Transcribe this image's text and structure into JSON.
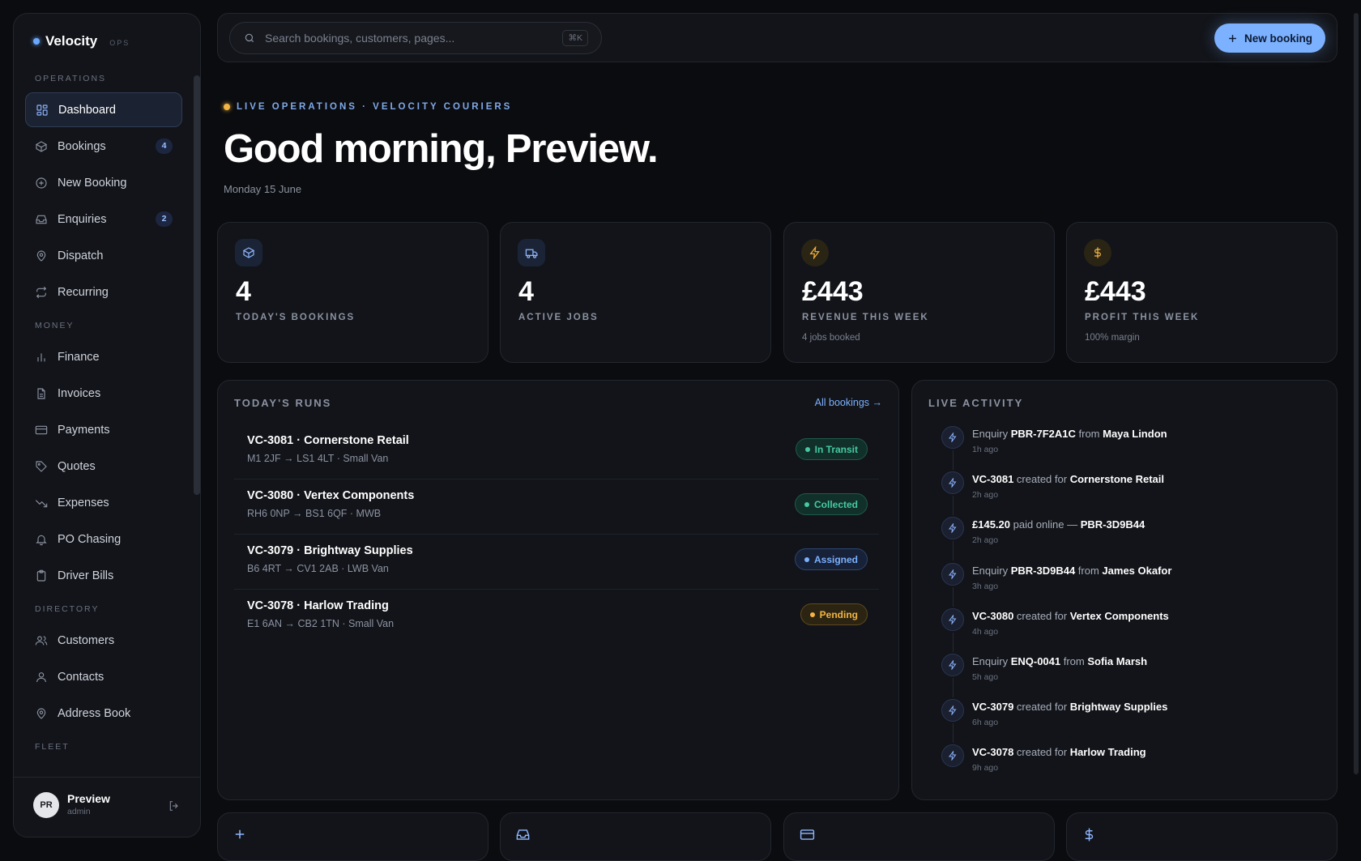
{
  "brand": {
    "name": "Velocity",
    "sub": "OPS"
  },
  "sidebar": {
    "sections": {
      "operations": "OPERATIONS",
      "money": "MONEY",
      "directory": "DIRECTORY",
      "fleet": "FLEET"
    },
    "items": [
      {
        "label": "Dashboard",
        "icon": "dashboard-icon"
      },
      {
        "label": "Bookings",
        "icon": "box-icon",
        "badge": "4"
      },
      {
        "label": "New Booking",
        "icon": "plus-circle-icon"
      },
      {
        "label": "Enquiries",
        "icon": "inbox-icon",
        "badge": "2"
      },
      {
        "label": "Dispatch",
        "icon": "map-pin-icon"
      },
      {
        "label": "Recurring",
        "icon": "repeat-icon"
      },
      {
        "label": "Finance",
        "icon": "bar-chart-icon"
      },
      {
        "label": "Invoices",
        "icon": "file-icon"
      },
      {
        "label": "Payments",
        "icon": "credit-card-icon"
      },
      {
        "label": "Quotes",
        "icon": "tag-icon"
      },
      {
        "label": "Expenses",
        "icon": "trending-down-icon"
      },
      {
        "label": "PO Chasing",
        "icon": "bell-icon"
      },
      {
        "label": "Driver Bills",
        "icon": "clipboard-icon"
      },
      {
        "label": "Customers",
        "icon": "users-icon"
      },
      {
        "label": "Contacts",
        "icon": "user-icon"
      },
      {
        "label": "Address Book",
        "icon": "map-pin-icon"
      }
    ],
    "user": {
      "initials": "PR",
      "name": "Preview",
      "role": "admin"
    }
  },
  "topbar": {
    "search_placeholder": "Search bookings, customers, pages...",
    "search_shortcut": "⌘K",
    "new_booking_label": "New booking"
  },
  "hero": {
    "eyebrow": "LIVE OPERATIONS · VELOCITY COURIERS",
    "greeting": "Good morning, Preview.",
    "date": "Monday 15 June"
  },
  "stats": [
    {
      "value": "4",
      "label": "TODAY'S BOOKINGS",
      "sub": "",
      "icon": "box-icon"
    },
    {
      "value": "4",
      "label": "ACTIVE JOBS",
      "sub": "",
      "icon": "truck-icon"
    },
    {
      "value": "£443",
      "label": "REVENUE THIS WEEK",
      "sub": "4 jobs booked",
      "icon": "bolt-icon"
    },
    {
      "value": "£443",
      "label": "PROFIT THIS WEEK",
      "sub": "100% margin",
      "icon": "dollar-icon"
    }
  ],
  "runs": {
    "title": "TODAY'S RUNS",
    "link": "All bookings →",
    "items": [
      {
        "title": "VC-3081 · Cornerstone Retail",
        "route": "M1 2JF → LS1 4LT · Small Van",
        "status": "In Transit",
        "status_color": "#46c9a0"
      },
      {
        "title": "VC-3080 · Vertex Components",
        "route": "RH6 0NP → BS1 6QF · MWB",
        "status": "Collected",
        "status_color": "#46c9a0"
      },
      {
        "title": "VC-3079 · Brightway Supplies",
        "route": "B6 4RT → CV1 2AB · LWB Van",
        "status": "Assigned",
        "status_color": "#7cb1ff"
      },
      {
        "title": "VC-3078 · Harlow Trading",
        "route": "E1 6AN → CB2 1TN · Small Van",
        "status": "Pending",
        "status_color": "#f2b544"
      }
    ]
  },
  "activity": {
    "title": "LIVE ACTIVITY",
    "items": [
      {
        "p1": "Enquiry ",
        "b1": "PBR-7F2A1C",
        "p2": " from ",
        "b2": "Maya Lindon",
        "time": "1h ago"
      },
      {
        "p1": "",
        "b1": "VC-3081",
        "p2": " created for ",
        "b2": "Cornerstone Retail",
        "time": "2h ago"
      },
      {
        "p1": "",
        "b1": "£145.20",
        "p2": " paid online — ",
        "b2": "PBR-3D9B44",
        "time": "2h ago"
      },
      {
        "p1": "Enquiry ",
        "b1": "PBR-3D9B44",
        "p2": " from ",
        "b2": "James Okafor",
        "time": "3h ago"
      },
      {
        "p1": "",
        "b1": "VC-3080",
        "p2": " created for ",
        "b2": "Vertex Components",
        "time": "4h ago"
      },
      {
        "p1": "Enquiry ",
        "b1": "ENQ-0041",
        "p2": " from ",
        "b2": "Sofia Marsh",
        "time": "5h ago"
      },
      {
        "p1": "",
        "b1": "VC-3079",
        "p2": " created for ",
        "b2": "Brightway Supplies",
        "time": "6h ago"
      },
      {
        "p1": "",
        "b1": "VC-3078",
        "p2": " created for ",
        "b2": "Harlow Trading",
        "time": "9h ago"
      }
    ]
  },
  "quick_actions": [
    {
      "icon": "plus-icon"
    },
    {
      "icon": "inbox-icon"
    },
    {
      "icon": "credit-card-icon"
    },
    {
      "icon": "dollar-icon"
    }
  ],
  "colors": {
    "accent": "#7cb1ff",
    "amber": "#f2b544",
    "teal": "#46c9a0",
    "bg": "#0b0c0f",
    "panel": "#121419"
  }
}
